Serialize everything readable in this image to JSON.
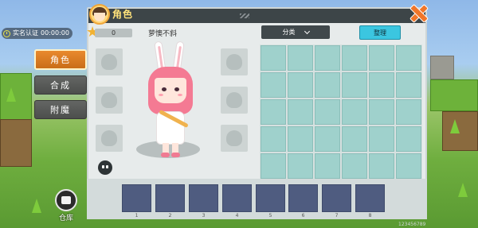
{
  "hud": {
    "realname_label": "实名认证",
    "realname_time": "00:00:00",
    "side_tabs": [
      {
        "label": "角色",
        "active": true
      },
      {
        "label": "合成",
        "active": false
      },
      {
        "label": "附魔",
        "active": false
      }
    ],
    "warehouse_label": "仓库"
  },
  "panel": {
    "title": "角色",
    "level_value": "0",
    "player_name": "萝懊不斜",
    "category_label": "分类",
    "sort_label": "整理"
  },
  "hotbar": {
    "slot_numbers": [
      "1",
      "2",
      "3",
      "4",
      "5",
      "6",
      "7",
      "8"
    ],
    "corner_number": "123456789"
  },
  "colors": {
    "active_tab": "#e98a2e",
    "close_button": "#f0762a",
    "sort_button": "#3bc6e0",
    "backpack_cell": "#9fd1cc",
    "hotbar_slot": "#4f5c80"
  }
}
